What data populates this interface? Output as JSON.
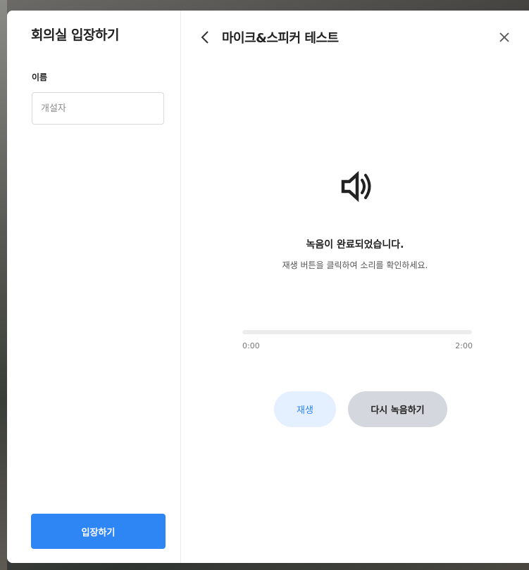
{
  "join_panel": {
    "title": "회의실 입장하기",
    "name_label": "이름",
    "name_placeholder": "개설자",
    "name_value": "",
    "enter_button": "입장하기"
  },
  "test_panel": {
    "title": "마이크&스피커 테스트",
    "icon": "speaker-icon",
    "status_title": "녹음이 완료되었습니다.",
    "status_description": "재생 버튼을 클릭하여 소리를 확인하세요.",
    "progress": {
      "current_time": "0:00",
      "total_time": "2:00",
      "fraction": 0
    },
    "play_button": "재생",
    "rerecord_button": "다시 녹음하기"
  },
  "colors": {
    "primary": "#2e86f5",
    "play_button_bg": "#e4efff",
    "rerecord_button_bg": "#d4d7dd",
    "track": "#ececec"
  }
}
